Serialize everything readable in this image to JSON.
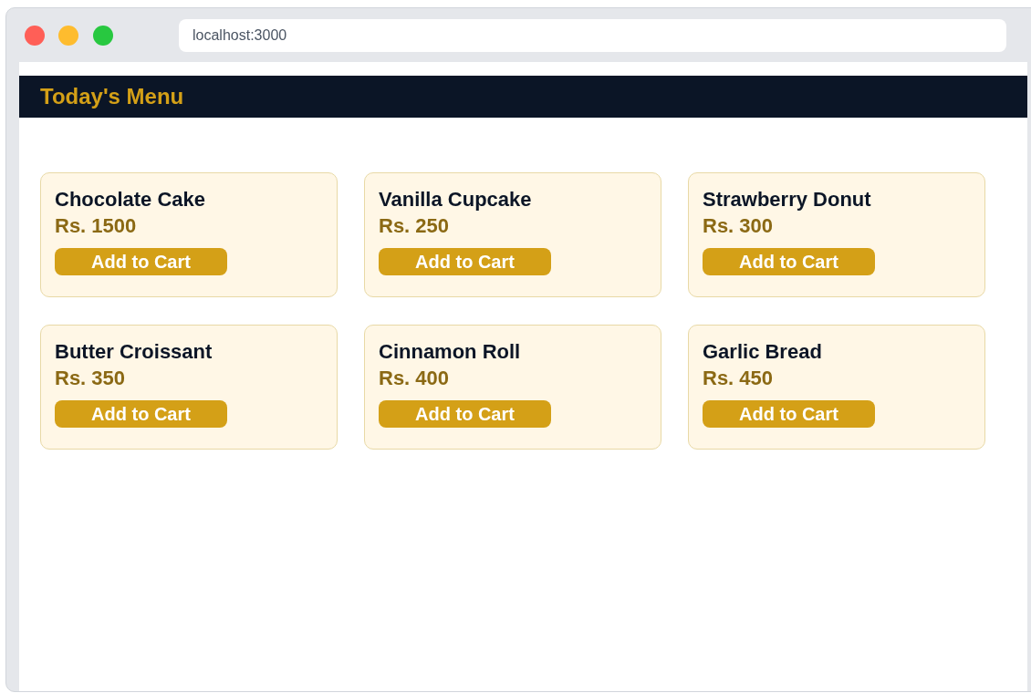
{
  "browser": {
    "url": "localhost:3000"
  },
  "header": {
    "title": "Today's Menu"
  },
  "items": [
    {
      "name": "Chocolate Cake",
      "price": "Rs. 1500",
      "button": "Add to Cart"
    },
    {
      "name": "Vanilla Cupcake",
      "price": "Rs. 250",
      "button": "Add to Cart"
    },
    {
      "name": "Strawberry Donut",
      "price": "Rs. 300",
      "button": "Add to Cart"
    },
    {
      "name": "Butter Croissant",
      "price": "Rs. 350",
      "button": "Add to Cart"
    },
    {
      "name": "Cinnamon Roll",
      "price": "Rs. 400",
      "button": "Add to Cart"
    },
    {
      "name": "Garlic Bread",
      "price": "Rs. 450",
      "button": "Add to Cart"
    }
  ]
}
